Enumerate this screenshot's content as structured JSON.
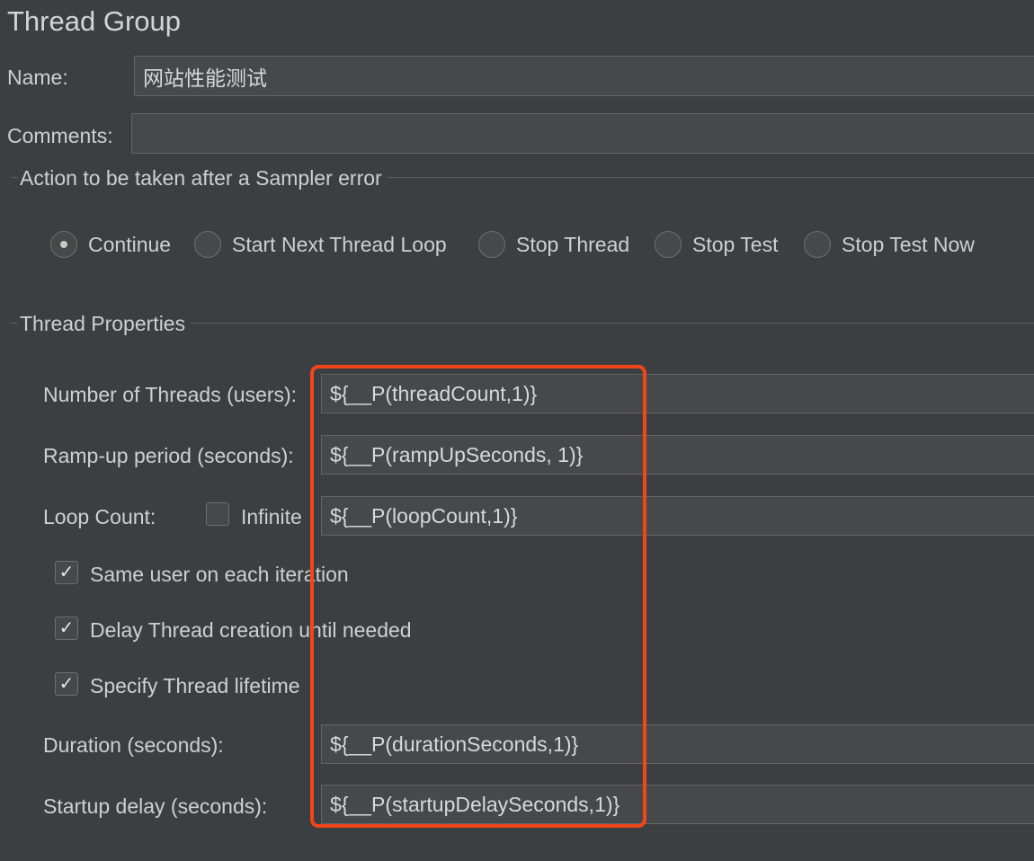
{
  "title": "Thread Group",
  "name": {
    "label": "Name:",
    "value": "网站性能测试"
  },
  "comments": {
    "label": "Comments:",
    "value": ""
  },
  "sampler_error": {
    "title": "Action to be taken after a Sampler error",
    "options": [
      {
        "label": "Continue",
        "selected": true
      },
      {
        "label": "Start Next Thread Loop",
        "selected": false
      },
      {
        "label": "Stop Thread",
        "selected": false
      },
      {
        "label": "Stop Test",
        "selected": false
      },
      {
        "label": "Stop Test Now",
        "selected": false
      }
    ]
  },
  "thread_properties": {
    "title": "Thread Properties",
    "num_threads": {
      "label": "Number of Threads (users):",
      "value": "${__P(threadCount,1)}"
    },
    "ramp_up": {
      "label": "Ramp-up period (seconds):",
      "value": "${__P(rampUpSeconds, 1)}"
    },
    "loop_count": {
      "label": "Loop Count:",
      "infinite_label": "Infinite",
      "infinite_checked": false,
      "value": "${__P(loopCount,1)}"
    },
    "same_user": {
      "label": "Same user on each iteration",
      "checked": true
    },
    "delay_creation": {
      "label": "Delay Thread creation until needed",
      "checked": true
    },
    "specify_lifetime": {
      "label": "Specify Thread lifetime",
      "checked": true
    },
    "duration": {
      "label": "Duration (seconds):",
      "value": "${__P(durationSeconds,1)}"
    },
    "startup_delay": {
      "label": "Startup delay (seconds):",
      "value": "${__P(startupDelaySeconds,1)}"
    }
  },
  "checkmark_glyph": "✓",
  "highlight_color": "#f0461a"
}
